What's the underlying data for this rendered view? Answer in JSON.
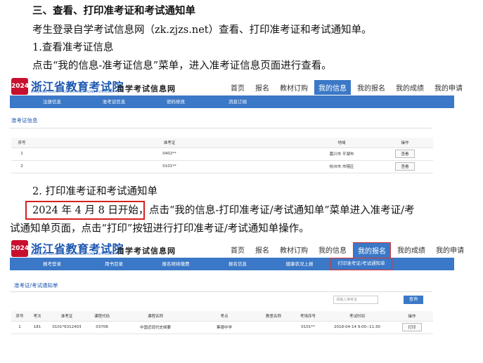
{
  "doc": {
    "heading": "三、查看、打印准考证和考试通知单",
    "intro": "考生登录自学考试信息网（zk.zjzs.net）查看、打印准考证和考试通知单。",
    "step1_title": "1.查看准考证信息",
    "step1_desc": "点击“我的信息-准考证信息”菜单，进入准考证信息页面进行查看。",
    "step2_title": "2. 打印准考证和考试通知单",
    "step2_date": "2024 年 4 月 8 日开始，",
    "step2_desc_rest": "点击“我的信息-打印准考证/考试通知单”菜单进入准考证/考",
    "step2_desc_line2": "试通知单页面，点击“打印”按钮进行打印准考证/考试通知单操作。"
  },
  "portal": {
    "logo_mark": "2024",
    "logo_cn": "浙江省教育考试院",
    "logo_en": "ZHEJIANG EDUCATION EXAMINATIONS AUTHORITY",
    "logo_sub": "自学考试信息网",
    "main_nav": [
      "首页",
      "报名",
      "教材订购",
      "我的信息",
      "我的报名",
      "我的成绩",
      "我的申请"
    ]
  },
  "shot1": {
    "sub_nav": [
      "注册信息",
      "准考证信息",
      "密码修改",
      "消息订阅"
    ],
    "section_title": "准考证信息",
    "columns": [
      "序号",
      "准考证",
      "地域",
      "操作"
    ],
    "rows": [
      {
        "no": "1",
        "ticket": "0402**",
        "region": "嘉兴市 平湖市",
        "action": "查看"
      },
      {
        "no": "2",
        "ticket": "0101**",
        "region": "杭州市 市辖区",
        "action": "查看"
      }
    ]
  },
  "shot2": {
    "sub_nav": [
      "报考登录",
      "用书目录",
      "报名继续缴费",
      "报名信息",
      "健康状况上报",
      "打印准考证/考试通知单"
    ],
    "section_title": "准考证/考试通知单",
    "search_placeholder": "请输入准考证",
    "search_button": "查询",
    "columns": [
      "序号",
      "考次",
      "准考证",
      "课程代码",
      "课程名称",
      "考点",
      "教室名称",
      "考场序号",
      "考试时间",
      "操作"
    ],
    "rows": [
      {
        "no": "1",
        "session": "181",
        "ticket": "0101*6312403",
        "code": "03708",
        "course": "中国近现代史纲要",
        "site": "筹德中学",
        "room": "",
        "seat": "0101**",
        "time": "2018-04-14 9:00--11:30",
        "action": "打印"
      }
    ]
  }
}
